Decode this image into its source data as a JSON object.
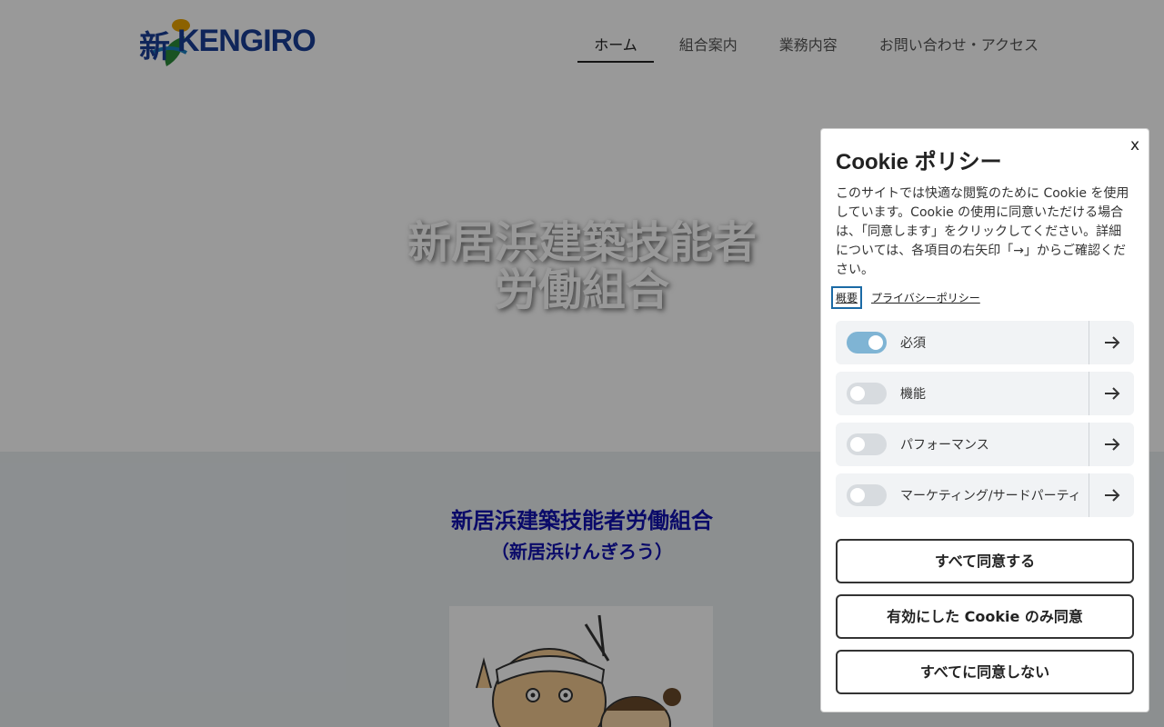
{
  "header": {
    "logo_text": "KENGIRO",
    "logo_kanji": "新",
    "nav": [
      "ホーム",
      "組合案内",
      "業務内容",
      "お問い合わせ・アクセス"
    ],
    "active_index": 0
  },
  "hero": {
    "title_line1": "新居浜建築技能者",
    "title_line2": "労働組合"
  },
  "content": {
    "title": "新居浜建築技能者労働組合",
    "subtitle": "（新居浜けんぎろう）"
  },
  "cookie": {
    "close": "x",
    "title": "Cookie ポリシー",
    "description": "このサイトでは快適な閲覧のために Cookie を使用しています。Cookie の使用に同意いただける場合は、「同意します」をクリックしてください。詳細については、各項目の右矢印「→」からご確認ください。",
    "links": [
      "概要",
      "プライバシーポリシー"
    ],
    "categories": [
      {
        "label": "必須",
        "enabled": true
      },
      {
        "label": "機能",
        "enabled": false
      },
      {
        "label": "パフォーマンス",
        "enabled": false
      },
      {
        "label": "マーケティング/サードパーティ",
        "enabled": false
      }
    ],
    "buttons": {
      "accept_all": "すべて同意する",
      "accept_selected": "有効にした Cookie のみ同意",
      "reject_all": "すべてに同意しない"
    }
  },
  "colors": {
    "brand_blue": "#1a3f96",
    "heading_blue": "#1112b0",
    "toggle_on": "#7fb4d4"
  }
}
